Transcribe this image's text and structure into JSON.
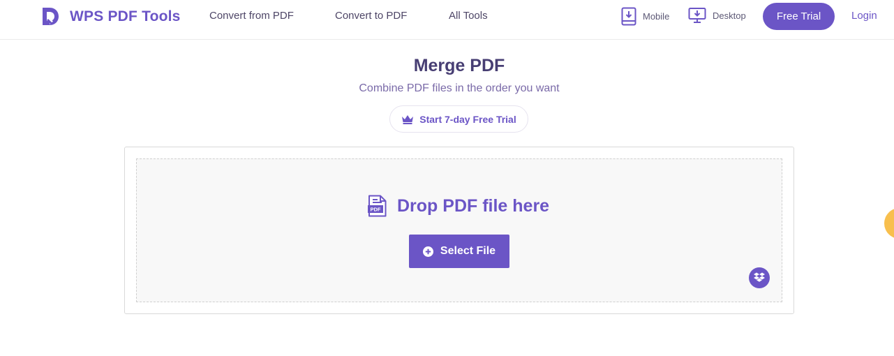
{
  "header": {
    "brand": "WPS PDF Tools",
    "nav": {
      "convert_from": "Convert from PDF",
      "convert_to": "Convert to PDF",
      "all_tools": "All Tools"
    },
    "downloads": {
      "mobile": "Mobile",
      "desktop": "Desktop"
    },
    "free_trial": "Free Trial",
    "login": "Login"
  },
  "hero": {
    "title": "Merge PDF",
    "subtitle": "Combine PDF files in the order you want",
    "trial_pill": "Start 7-day Free Trial"
  },
  "dropzone": {
    "prompt": "Drop PDF file here",
    "file_badge": "PDF",
    "select_button": "Select File"
  },
  "icons": {
    "logo": "wps-logo-icon",
    "mobile": "mobile-download-icon",
    "desktop": "desktop-download-icon",
    "crown": "crown-icon",
    "pdf_file": "pdf-file-icon",
    "plus": "plus-circle-icon",
    "dropbox": "dropbox-icon"
  },
  "colors": {
    "brand": "#6b55c6",
    "title": "#473e73",
    "subtitle": "#7a6aa8",
    "dropzone_bg": "#f8f8f8",
    "side_badge": "#f8bf4d"
  }
}
